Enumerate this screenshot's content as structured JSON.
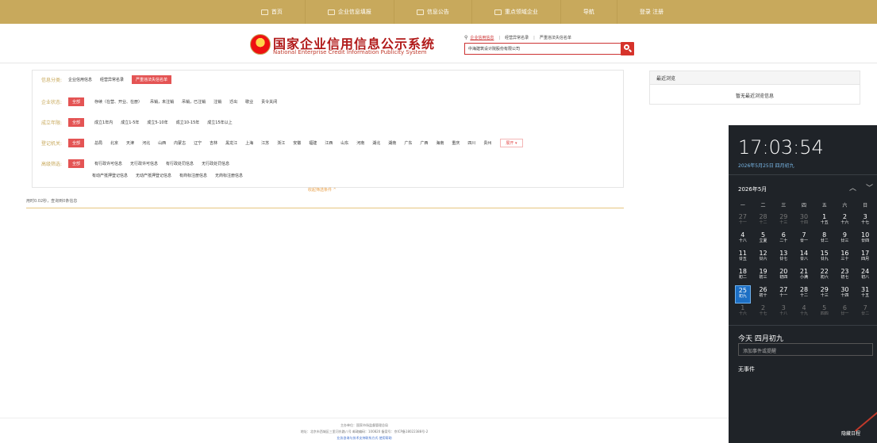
{
  "topnav": {
    "items": [
      {
        "label": "首页",
        "icon": "home-icon"
      },
      {
        "label": "企业信息填报",
        "icon": "edit-icon"
      },
      {
        "label": "信息公告",
        "icon": "notice-icon"
      },
      {
        "label": "重点领域企业",
        "icon": "star-icon"
      },
      {
        "label": "导航",
        "icon": ""
      },
      {
        "label": "登录 注册",
        "icon": ""
      }
    ]
  },
  "header": {
    "title_cn": "国家企业信用信息公示系统",
    "title_en": "National Enterprise Credit Information Publicity System",
    "search_tabs": [
      "企业信用信息",
      "经营异常名录",
      "严重违法失信名单"
    ],
    "search_value": "中海建筑设计院股份有限公司"
  },
  "filters": {
    "rows": [
      {
        "label": "信息分类:",
        "options": [
          "企业信用信息",
          "经营异常名录",
          "严重违法失信名单"
        ],
        "selected": 2
      },
      {
        "label": "企业状态:",
        "options": [
          "全部",
          "存续（在营、开业、在册）",
          "吊销，未注销",
          "吊销，已注销",
          "注销",
          "迁出",
          "歇业",
          "责令关闭"
        ],
        "selected": 0
      },
      {
        "label": "成立年限:",
        "options": [
          "全部",
          "成立1年内",
          "成立1-5年",
          "成立5-10年",
          "成立10-15年",
          "成立15年以上"
        ],
        "selected": 0
      },
      {
        "label": "登记机关:",
        "options": [
          "全部",
          "总局",
          "北京",
          "天津",
          "河北",
          "山西",
          "内蒙古",
          "辽宁",
          "吉林",
          "黑龙江",
          "上海",
          "江苏",
          "浙江",
          "安徽",
          "福建",
          "江西",
          "山东",
          "河南",
          "湖北",
          "湖南",
          "广东",
          "广西",
          "海南",
          "重庆",
          "四川",
          "贵州"
        ],
        "selected": 0,
        "expand": "展开 ▾"
      },
      {
        "label": "高级筛选:",
        "options": [
          "全部",
          "有行政许可信息",
          "无行政许可信息",
          "有行政处罚信息",
          "无行政处罚信息"
        ],
        "selected": 0
      },
      {
        "label": "",
        "options": [
          "有动产抵押登记信息",
          "无动产抵押登记信息",
          "有商标注册信息",
          "无商标注册信息"
        ],
        "selected": -1
      }
    ],
    "collapse_label": "收起筛选条件 ^",
    "stats": "用时0.02秒，查询到0条信息"
  },
  "recent": {
    "title": "最近浏览",
    "empty": "暂无最近浏览信息"
  },
  "footer": {
    "line1": "主办单位：国家市场监督管理总局",
    "line2": "地址：北京市西城区三里河东路八号  邮政编码：100820  备案号：京ICP备18022388号-2",
    "line3": "业务咨询与技术支持联系方式    使用帮助"
  },
  "flyout": {
    "time": "17:03:54",
    "date": "2026年5月25日 四月初九",
    "month": "2026年5月",
    "weekdays": [
      "一",
      "二",
      "三",
      "四",
      "五",
      "六",
      "日"
    ],
    "days": [
      {
        "n": "27",
        "l": "十一",
        "dim": true
      },
      {
        "n": "28",
        "l": "十二",
        "dim": true
      },
      {
        "n": "29",
        "l": "十三",
        "dim": true
      },
      {
        "n": "30",
        "l": "十四",
        "dim": true
      },
      {
        "n": "1",
        "l": "十五"
      },
      {
        "n": "2",
        "l": "十六"
      },
      {
        "n": "3",
        "l": "十七"
      },
      {
        "n": "4",
        "l": "十八"
      },
      {
        "n": "5",
        "l": "立夏"
      },
      {
        "n": "6",
        "l": "二十"
      },
      {
        "n": "7",
        "l": "廿一"
      },
      {
        "n": "8",
        "l": "廿二"
      },
      {
        "n": "9",
        "l": "廿三"
      },
      {
        "n": "10",
        "l": "廿四"
      },
      {
        "n": "11",
        "l": "廿五"
      },
      {
        "n": "12",
        "l": "廿六"
      },
      {
        "n": "13",
        "l": "廿七"
      },
      {
        "n": "14",
        "l": "廿八"
      },
      {
        "n": "15",
        "l": "廿九"
      },
      {
        "n": "16",
        "l": "三十"
      },
      {
        "n": "17",
        "l": "四月"
      },
      {
        "n": "18",
        "l": "初二"
      },
      {
        "n": "19",
        "l": "初三"
      },
      {
        "n": "20",
        "l": "初四"
      },
      {
        "n": "21",
        "l": "小满"
      },
      {
        "n": "22",
        "l": "初六"
      },
      {
        "n": "23",
        "l": "初七"
      },
      {
        "n": "24",
        "l": "初八"
      },
      {
        "n": "25",
        "l": "初九",
        "today": true
      },
      {
        "n": "26",
        "l": "初十"
      },
      {
        "n": "27",
        "l": "十一"
      },
      {
        "n": "28",
        "l": "十二"
      },
      {
        "n": "29",
        "l": "十三"
      },
      {
        "n": "30",
        "l": "十四"
      },
      {
        "n": "31",
        "l": "十五"
      },
      {
        "n": "1",
        "l": "十六",
        "dim": true
      },
      {
        "n": "2",
        "l": "十七",
        "dim": true
      },
      {
        "n": "3",
        "l": "十八",
        "dim": true
      },
      {
        "n": "4",
        "l": "十九",
        "dim": true
      },
      {
        "n": "5",
        "l": "四四",
        "dim": true
      },
      {
        "n": "6",
        "l": "廿一",
        "dim": true
      },
      {
        "n": "7",
        "l": "廿二",
        "dim": true
      }
    ],
    "today_label": "今天 四月初九",
    "event_placeholder": "添加事件或提醒",
    "no_events": "无事件",
    "hide_label": "隐藏日程"
  }
}
